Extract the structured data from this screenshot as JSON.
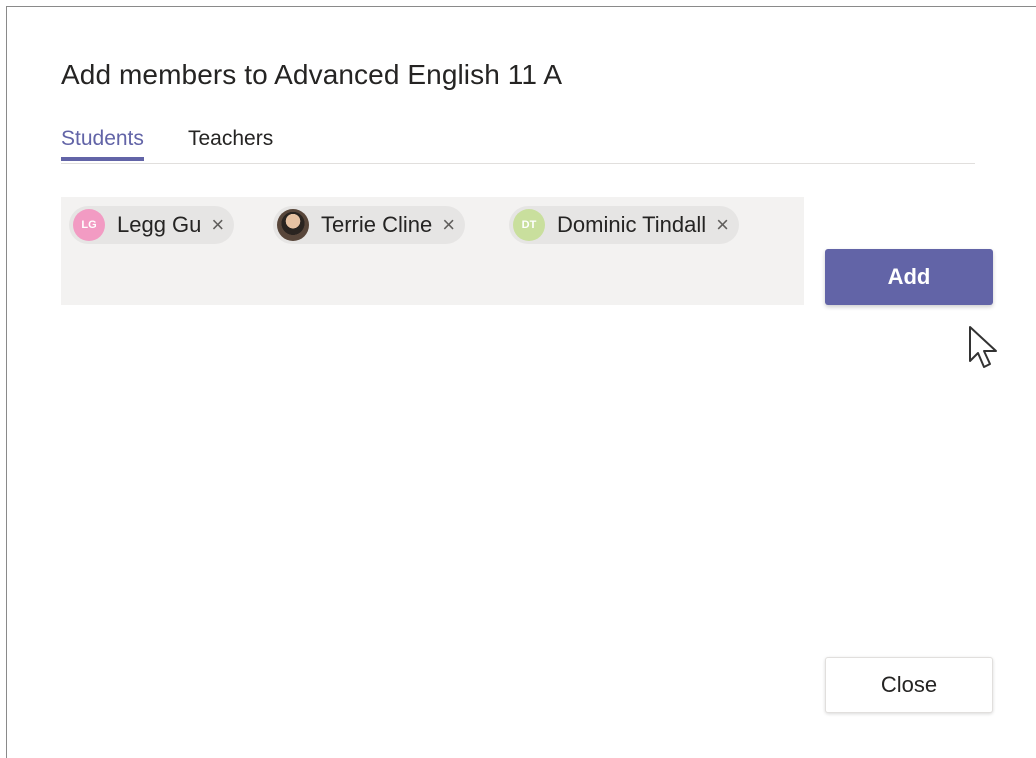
{
  "dialog": {
    "title": "Add members to Advanced English 11 A"
  },
  "tabs": [
    {
      "label": "Students",
      "active": true
    },
    {
      "label": "Teachers",
      "active": false
    }
  ],
  "picker": {
    "selected_members": [
      {
        "name": "Legg Gu",
        "initials": "LG",
        "avatar_color": "#f29bc3",
        "avatar_type": "initials"
      },
      {
        "name": "Terrie Cline",
        "initials": "",
        "avatar_color": "#3a2f28",
        "avatar_type": "photo"
      },
      {
        "name": "Dominic Tindall",
        "initials": "DT",
        "avatar_color": "#c9df9d",
        "avatar_type": "initials"
      }
    ],
    "remove_glyph": "×"
  },
  "buttons": {
    "add_label": "Add",
    "close_label": "Close"
  },
  "colors": {
    "accent": "#6264a7",
    "picker_background": "#f3f2f1",
    "pill_background": "#e6e5e4"
  }
}
